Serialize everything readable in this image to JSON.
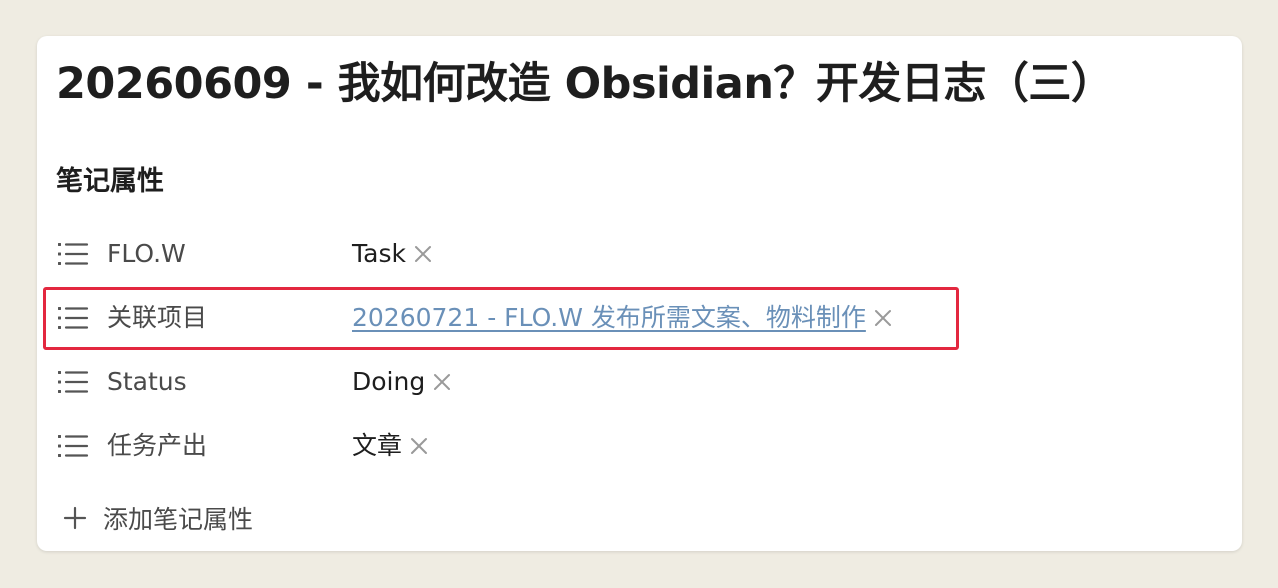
{
  "note": {
    "title": "20260609 - 我如何改造 Obsidian？开发日志（三）"
  },
  "properties": {
    "heading": "笔记属性",
    "items": [
      {
        "key": "FLO.W",
        "value": "Task",
        "is_link": false
      },
      {
        "key": "关联项目",
        "value": "20260721 - FLO.W 发布所需文案、物料制作",
        "is_link": true
      },
      {
        "key": "Status",
        "value": "Doing",
        "is_link": false
      },
      {
        "key": "任务产出",
        "value": "文章",
        "is_link": false
      }
    ],
    "add_label": "添加笔记属性"
  },
  "icons": {
    "property_type": "list-icon",
    "remove": "close-icon",
    "add": "plus-icon"
  },
  "colors": {
    "background": "#efece2",
    "link": "#6a90b8",
    "highlight_border": "#e3283f"
  }
}
